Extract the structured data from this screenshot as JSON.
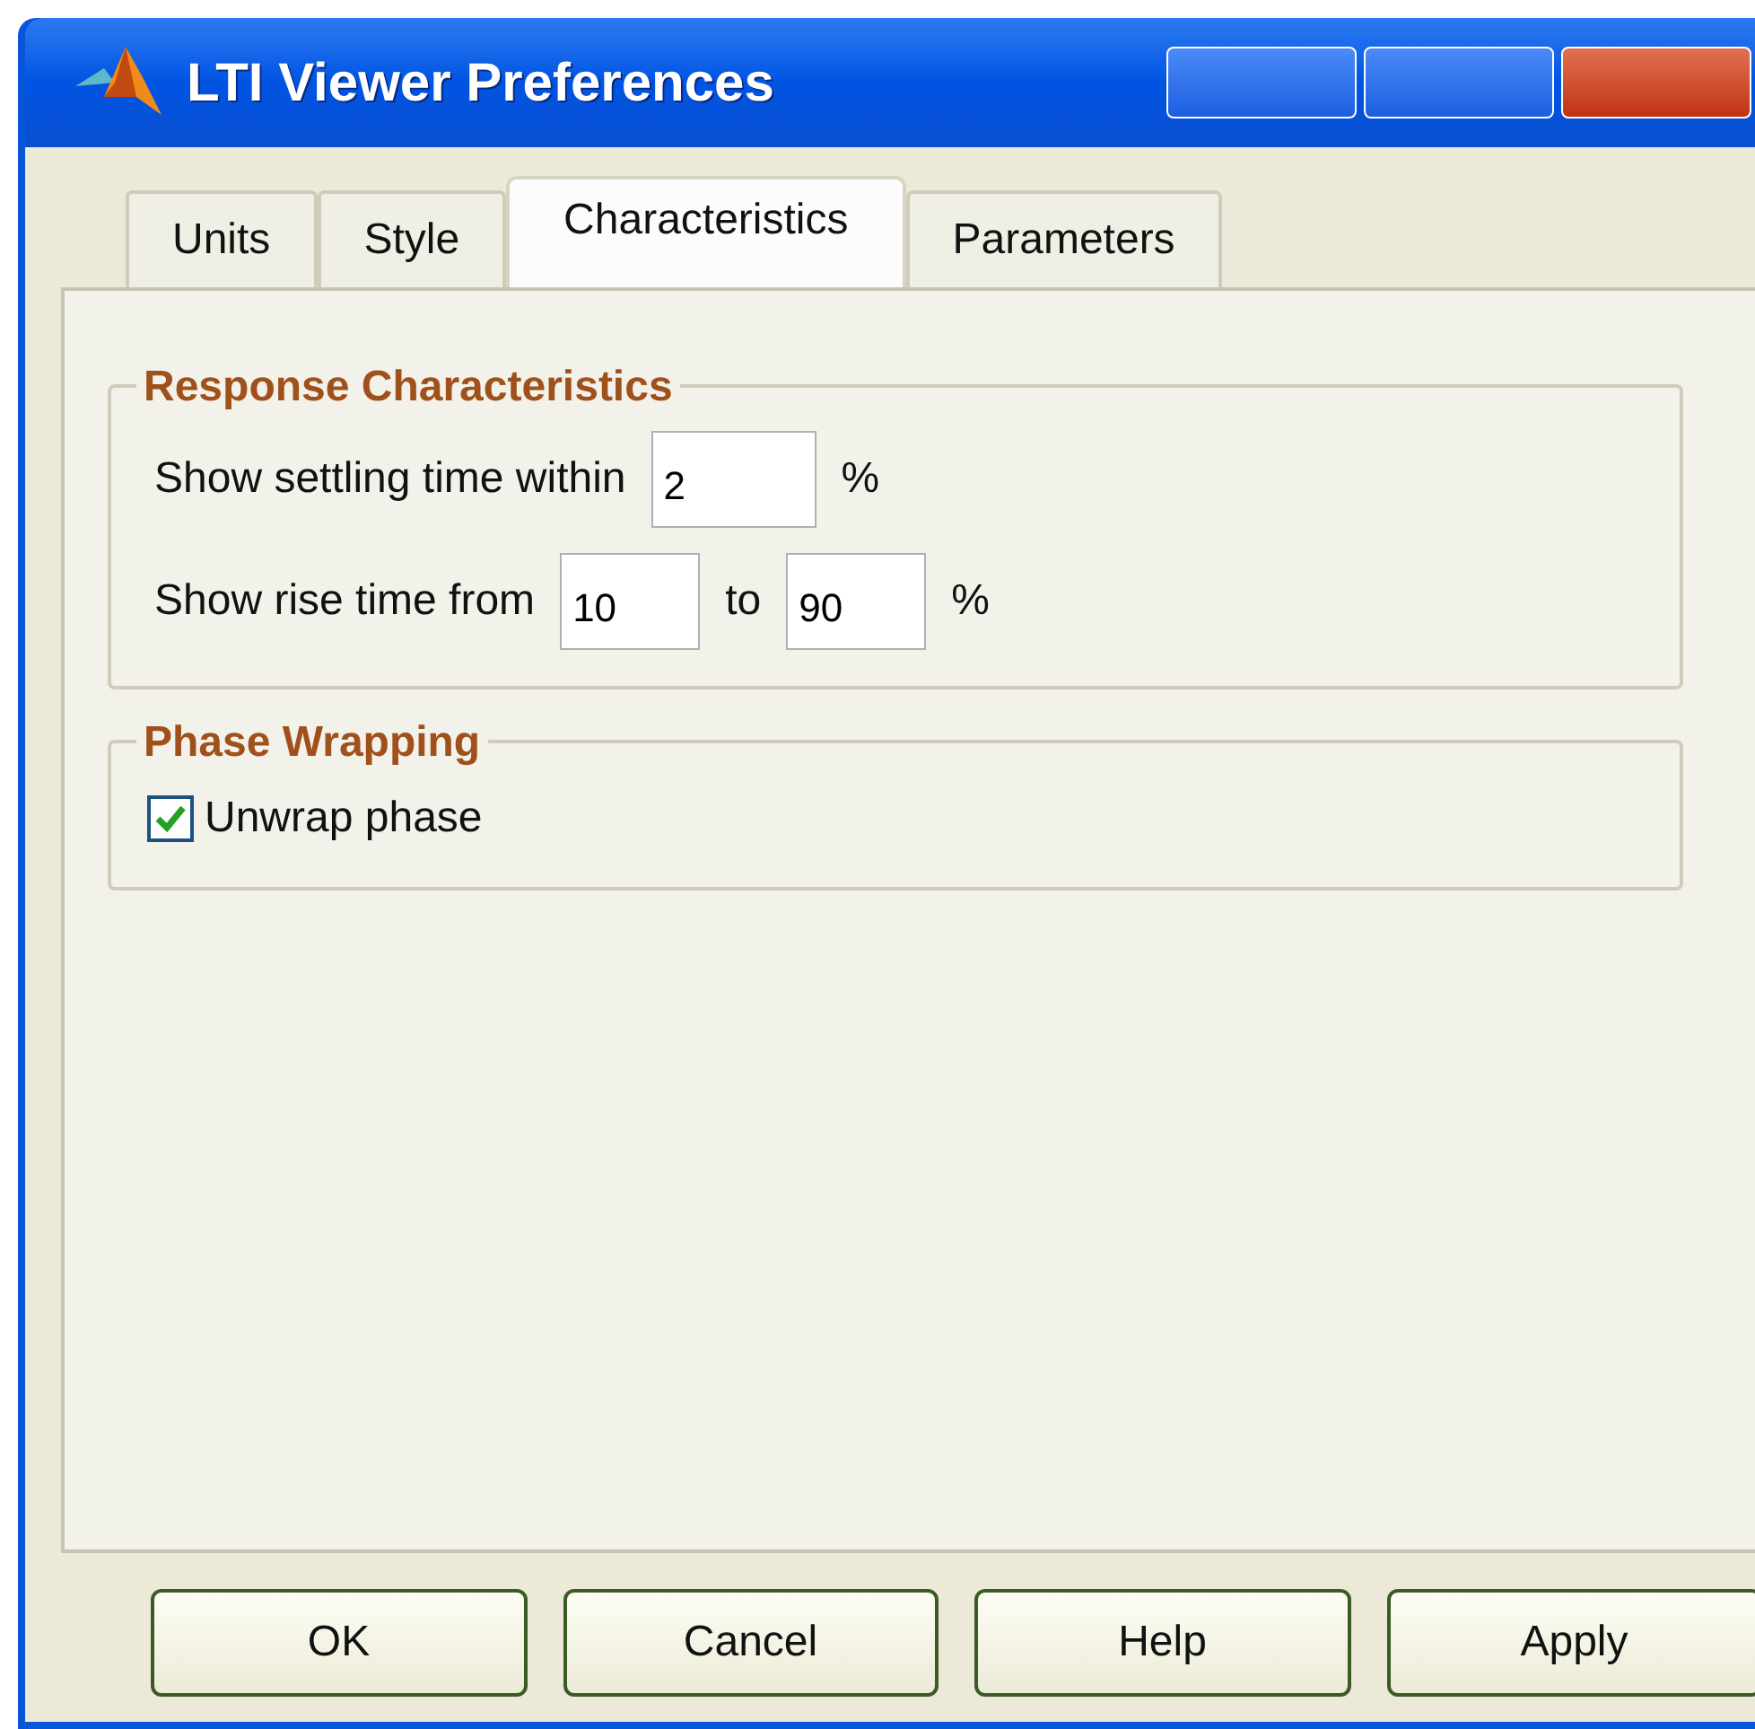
{
  "window": {
    "title": "LTI Viewer Preferences"
  },
  "tabs": [
    {
      "label": "Units",
      "selected": false
    },
    {
      "label": "Style",
      "selected": false
    },
    {
      "label": "Characteristics",
      "selected": true
    },
    {
      "label": "Parameters",
      "selected": false
    }
  ],
  "groups": [
    {
      "title": "Response Characteristics",
      "rows": [
        {
          "kind": "fields",
          "parts": [
            {
              "kind": "text",
              "text": "Show settling time within"
            },
            {
              "kind": "field",
              "value": "2"
            },
            {
              "kind": "text",
              "text": "%"
            }
          ]
        },
        {
          "kind": "fields",
          "parts": [
            {
              "kind": "text",
              "text": "Show rise time from"
            },
            {
              "kind": "field",
              "value": "10"
            },
            {
              "kind": "text",
              "text": "to"
            },
            {
              "kind": "field",
              "value": "90"
            },
            {
              "kind": "text",
              "text": "%"
            }
          ]
        }
      ]
    },
    {
      "title": "Phase Wrapping",
      "rows": [
        {
          "kind": "checkbox",
          "label": "Unwrap phase",
          "checked": true
        }
      ]
    }
  ],
  "buttons": [
    "OK",
    "Cancel",
    "Help",
    "Apply"
  ]
}
